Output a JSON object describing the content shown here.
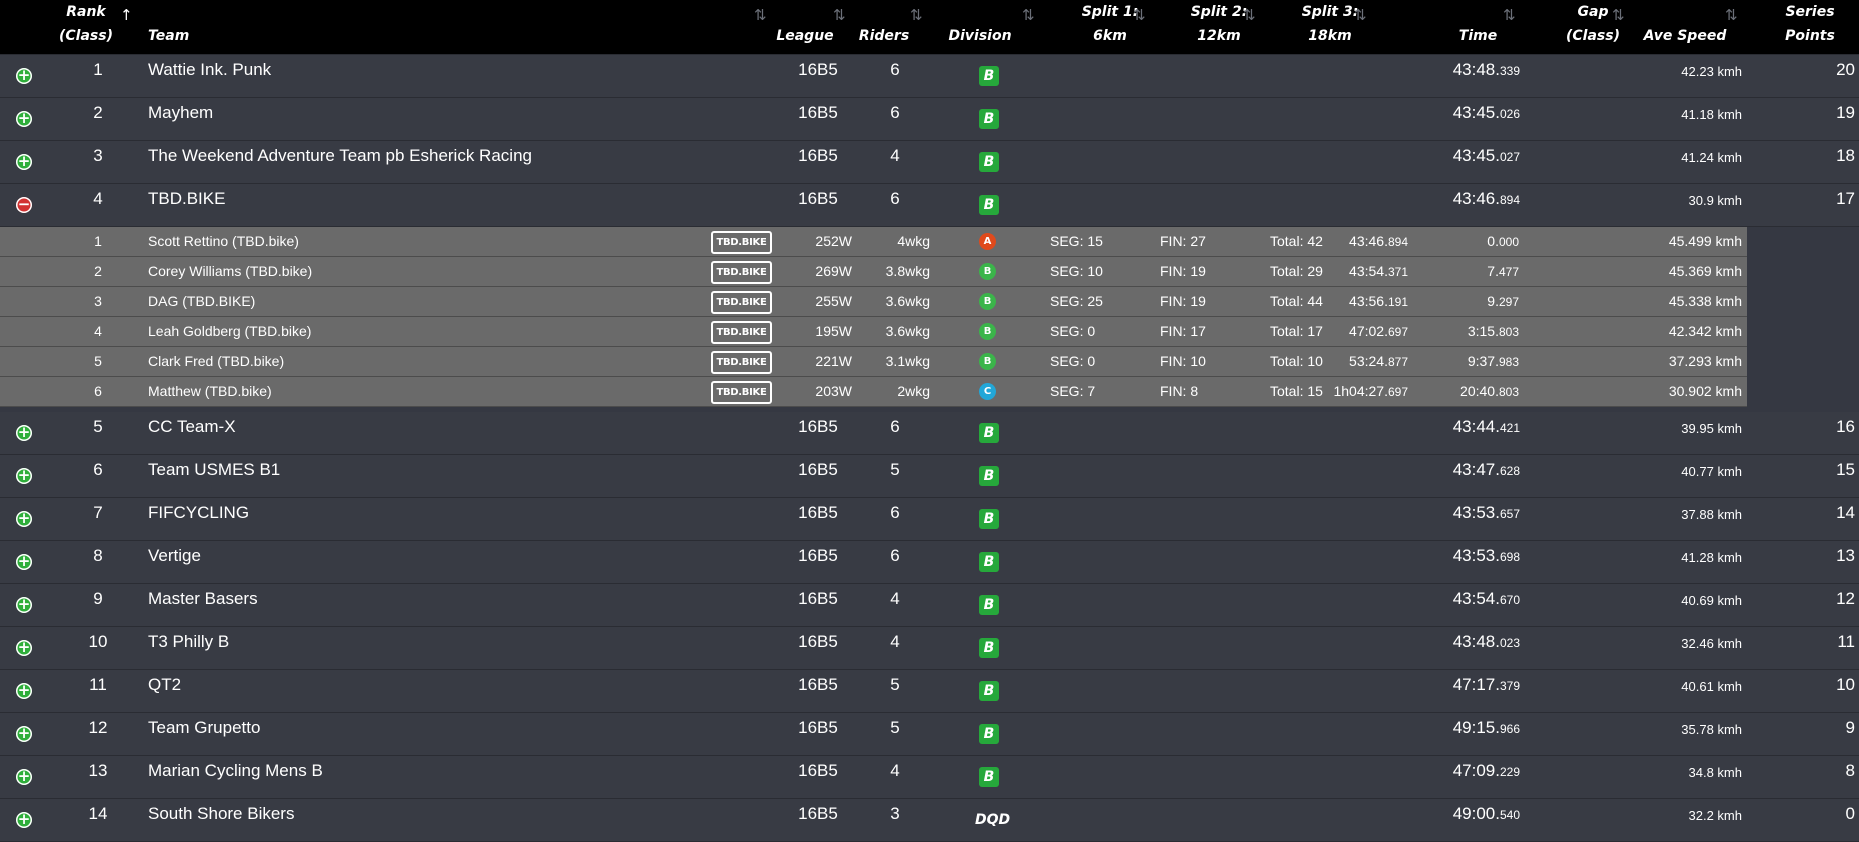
{
  "columns": {
    "rank": [
      "Rank",
      "(Class)"
    ],
    "team": "Team",
    "league": "League",
    "riders": "Riders",
    "division": "Division",
    "split1": [
      "Split 1:",
      "6km"
    ],
    "split2": [
      "Split 2:",
      "12km"
    ],
    "split3": [
      "Split 3:",
      "18km"
    ],
    "time": "Time",
    "gap": [
      "Gap",
      "(Class)"
    ],
    "ave_speed": "Ave Speed",
    "series": [
      "Series",
      "Points"
    ]
  },
  "teams": [
    {
      "rank": "1",
      "team": "Wattie Ink. Punk",
      "league": "16B5",
      "riders": "6",
      "division": "B",
      "time_main": "43:48.",
      "time_ms": "339",
      "speed": "42.23 kmh",
      "points": "20",
      "expanded": false
    },
    {
      "rank": "2",
      "team": "Mayhem",
      "league": "16B5",
      "riders": "6",
      "division": "B",
      "time_main": "43:45.",
      "time_ms": "026",
      "speed": "41.18 kmh",
      "points": "19",
      "expanded": false
    },
    {
      "rank": "3",
      "team": "The Weekend Adventure Team pb Esherick Racing",
      "league": "16B5",
      "riders": "4",
      "division": "B",
      "time_main": "43:45.",
      "time_ms": "027",
      "speed": "41.24 kmh",
      "points": "18",
      "expanded": false
    },
    {
      "rank": "4",
      "team": "TBD.BIKE",
      "league": "16B5",
      "riders": "6",
      "division": "B",
      "time_main": "43:46.",
      "time_ms": "894",
      "speed": "30.9 kmh",
      "points": "17",
      "expanded": true
    },
    {
      "rank": "5",
      "team": "CC Team-X",
      "league": "16B5",
      "riders": "6",
      "division": "B",
      "time_main": "43:44.",
      "time_ms": "421",
      "speed": "39.95 kmh",
      "points": "16",
      "expanded": false
    },
    {
      "rank": "6",
      "team": "Team USMES B1",
      "league": "16B5",
      "riders": "5",
      "division": "B",
      "time_main": "43:47.",
      "time_ms": "628",
      "speed": "40.77 kmh",
      "points": "15",
      "expanded": false
    },
    {
      "rank": "7",
      "team": "FIFCYCLING",
      "league": "16B5",
      "riders": "6",
      "division": "B",
      "time_main": "43:53.",
      "time_ms": "657",
      "speed": "37.88 kmh",
      "points": "14",
      "expanded": false
    },
    {
      "rank": "8",
      "team": "Vertige",
      "league": "16B5",
      "riders": "6",
      "division": "B",
      "time_main": "43:53.",
      "time_ms": "698",
      "speed": "41.28 kmh",
      "points": "13",
      "expanded": false
    },
    {
      "rank": "9",
      "team": "Master Basers",
      "league": "16B5",
      "riders": "4",
      "division": "B",
      "time_main": "43:54.",
      "time_ms": "670",
      "speed": "40.69 kmh",
      "points": "12",
      "expanded": false
    },
    {
      "rank": "10",
      "team": "T3 Philly B",
      "league": "16B5",
      "riders": "4",
      "division": "B",
      "time_main": "43:48.",
      "time_ms": "023",
      "speed": "32.46 kmh",
      "points": "11",
      "expanded": false
    },
    {
      "rank": "11",
      "team": "QT2",
      "league": "16B5",
      "riders": "5",
      "division": "B",
      "time_main": "47:17.",
      "time_ms": "379",
      "speed": "40.61 kmh",
      "points": "10",
      "expanded": false
    },
    {
      "rank": "12",
      "team": "Team Grupetto",
      "league": "16B5",
      "riders": "5",
      "division": "B",
      "time_main": "49:15.",
      "time_ms": "966",
      "speed": "35.78 kmh",
      "points": "9",
      "expanded": false
    },
    {
      "rank": "13",
      "team": "Marian Cycling Mens B",
      "league": "16B5",
      "riders": "4",
      "division": "B",
      "time_main": "47:09.",
      "time_ms": "229",
      "speed": "34.8 kmh",
      "points": "8",
      "expanded": false
    },
    {
      "rank": "14",
      "team": "South Shore Bikers",
      "league": "16B5",
      "riders": "3",
      "division": "DQD",
      "time_main": "49:00.",
      "time_ms": "540",
      "speed": "32.2 kmh",
      "points": "0",
      "expanded": false
    }
  ],
  "riders": [
    {
      "rank": "1",
      "name": "Scott Rettino (TBD.bike)",
      "tag": "TBD.BIKE",
      "watts": "252W",
      "wkg": "4wkg",
      "division": "A",
      "seg": "SEG: 15",
      "fin": "FIN: 27",
      "total": "Total: 42",
      "time_main": "43:46.",
      "time_ms": "894",
      "gap_main": "0.",
      "gap_ms": "000",
      "speed": "45.499 kmh"
    },
    {
      "rank": "2",
      "name": "Corey Williams (TBD.bike)",
      "tag": "TBD.BIKE",
      "watts": "269W",
      "wkg": "3.8wkg",
      "division": "B",
      "seg": "SEG: 10",
      "fin": "FIN: 19",
      "total": "Total: 29",
      "time_main": "43:54.",
      "time_ms": "371",
      "gap_main": "7.",
      "gap_ms": "477",
      "speed": "45.369 kmh"
    },
    {
      "rank": "3",
      "name": "DAG (TBD.BIKE)",
      "tag": "TBD.BIKE",
      "watts": "255W",
      "wkg": "3.6wkg",
      "division": "B",
      "seg": "SEG: 25",
      "fin": "FIN: 19",
      "total": "Total: 44",
      "time_main": "43:56.",
      "time_ms": "191",
      "gap_main": "9.",
      "gap_ms": "297",
      "speed": "45.338 kmh"
    },
    {
      "rank": "4",
      "name": "Leah Goldberg (TBD.bike)",
      "tag": "TBD.BIKE",
      "watts": "195W",
      "wkg": "3.6wkg",
      "division": "B",
      "seg": "SEG: 0",
      "fin": "FIN: 17",
      "total": "Total: 17",
      "time_main": "47:02.",
      "time_ms": "697",
      "gap_main": "3:15.",
      "gap_ms": "803",
      "speed": "42.342 kmh"
    },
    {
      "rank": "5",
      "name": "Clark Fred (TBD.bike)",
      "tag": "TBD.BIKE",
      "watts": "221W",
      "wkg": "3.1wkg",
      "division": "B",
      "seg": "SEG: 0",
      "fin": "FIN: 10",
      "total": "Total: 10",
      "time_main": "53:24.",
      "time_ms": "877",
      "gap_main": "9:37.",
      "gap_ms": "983",
      "speed": "37.293 kmh"
    },
    {
      "rank": "6",
      "name": "Matthew (TBD.bike)",
      "tag": "TBD.BIKE",
      "watts": "203W",
      "wkg": "2wkg",
      "division": "C",
      "seg": "SEG: 7",
      "fin": "FIN: 8",
      "total": "Total: 15",
      "time_main": "1h04:27.",
      "time_ms": "697",
      "gap_main": "20:40.",
      "gap_ms": "803",
      "speed": "30.902 kmh"
    }
  ],
  "colors": {
    "header_bg": "#000000",
    "row_bg": "#383b44",
    "rider_row_bg": "#6a6a6a",
    "division_b": "#26a83b",
    "rider_div_a": "#e04a1c",
    "rider_div_b": "#3bb54a",
    "rider_div_c": "#22a7d8",
    "expand_green": "#2eae3a",
    "collapse_red": "#d23131"
  },
  "icons": {
    "expand": "plus-circle-icon",
    "collapse": "minus-circle-icon",
    "sort": "sort-arrows-icon"
  }
}
